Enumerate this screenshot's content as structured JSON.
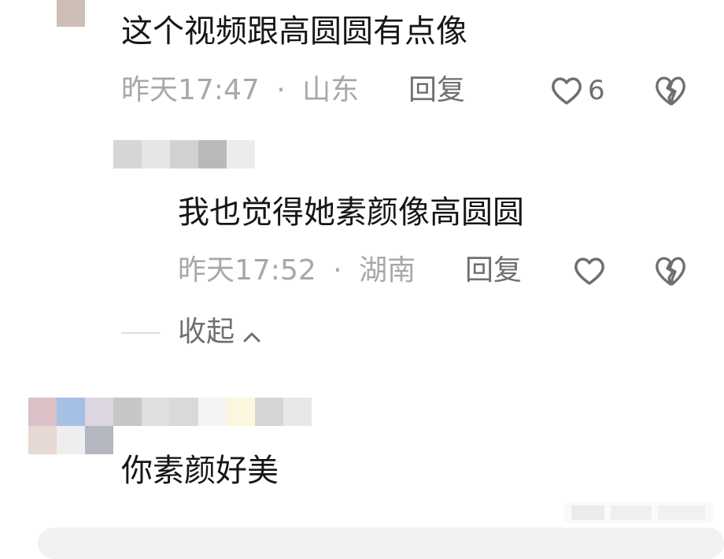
{
  "comments": [
    {
      "text": "这个视频跟高圆圆有点像",
      "time": "昨天17:47",
      "sep": "·",
      "location": "山东",
      "reply_label": "回复",
      "like_count": "6"
    },
    {
      "text": "我也觉得她素颜像高圆圆",
      "time": "昨天17:52",
      "sep": "·",
      "location": "湖南",
      "reply_label": "回复"
    },
    {
      "text": "你素颜好美"
    }
  ],
  "collapse_label": "收起",
  "icons": {
    "like": "heart-outline-icon",
    "dislike": "broken-heart-icon",
    "collapse": "chevron-up-icon"
  },
  "colors": {
    "text": "#161616",
    "meta": "#a8a8a8",
    "action": "#6f6f6f",
    "bottom_bar": "#f2f2f2"
  }
}
